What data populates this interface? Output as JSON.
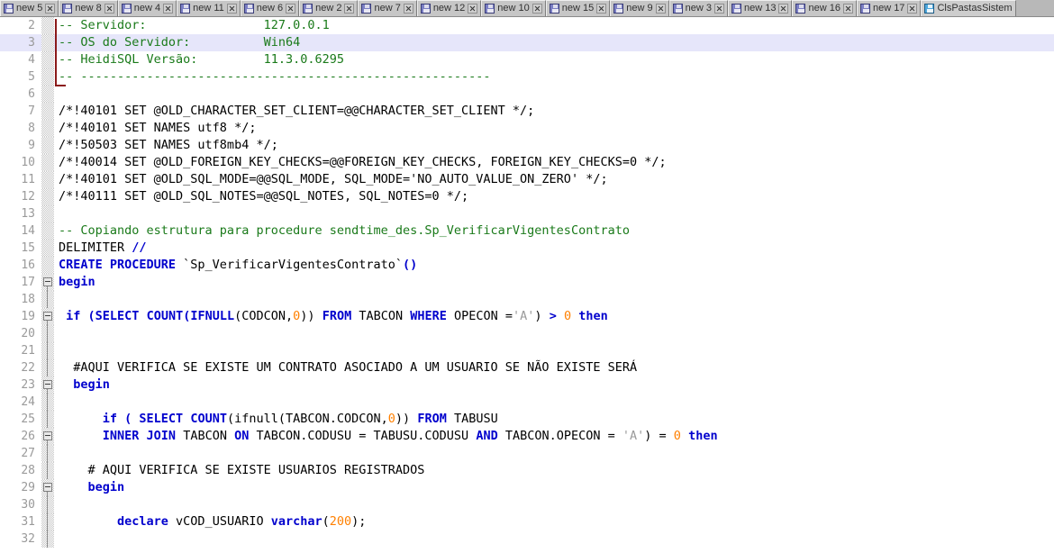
{
  "tabs": {
    "items": [
      {
        "label": "new 5",
        "icon": "floppy-disk-icon",
        "active": false
      },
      {
        "label": "new 8",
        "icon": "floppy-disk-icon",
        "active": false
      },
      {
        "label": "new 4",
        "icon": "floppy-disk-icon",
        "active": false
      },
      {
        "label": "new 11",
        "icon": "floppy-disk-icon",
        "active": false
      },
      {
        "label": "new 6",
        "icon": "floppy-disk-icon",
        "active": false
      },
      {
        "label": "new 2",
        "icon": "floppy-disk-icon",
        "active": false
      },
      {
        "label": "new 7",
        "icon": "floppy-disk-icon",
        "active": false
      },
      {
        "label": "new 12",
        "icon": "floppy-disk-icon",
        "active": false
      },
      {
        "label": "new 10",
        "icon": "floppy-disk-icon",
        "active": false
      },
      {
        "label": "new 15",
        "icon": "floppy-disk-icon",
        "active": false
      },
      {
        "label": "new 9",
        "icon": "floppy-disk-icon",
        "active": false
      },
      {
        "label": "new 3",
        "icon": "floppy-disk-icon",
        "active": false
      },
      {
        "label": "new 13",
        "icon": "floppy-disk-icon",
        "active": false
      },
      {
        "label": "new 16",
        "icon": "floppy-disk-icon",
        "active": false
      },
      {
        "label": "new 17",
        "icon": "floppy-disk-icon",
        "active": false
      },
      {
        "label": "ClsPastasSistem",
        "icon": "floppy-disk-icon",
        "active": true
      }
    ],
    "close_icon": "close-icon"
  },
  "editor": {
    "current_line": 3,
    "colors": {
      "keyword": "#0000cd",
      "comment": "#1a7a1a",
      "number": "#ff8000",
      "string": "#9a9a9a",
      "plain": "#000000",
      "current_line_bg": "#e6e6fa",
      "gutter_text": "#9a9a9a",
      "fold_bracket": "#8b1a1a"
    },
    "lines": [
      {
        "n": "2",
        "fold": "none",
        "tokens": [
          {
            "t": "-- Servidor:                ",
            "c": "cmt"
          },
          {
            "t": "127.0.0.1",
            "c": "cmt"
          }
        ]
      },
      {
        "n": "3",
        "fold": "none",
        "tokens": [
          {
            "t": "-- OS do Servidor:          ",
            "c": "cmt"
          },
          {
            "t": "Win64",
            "c": "cmt"
          }
        ]
      },
      {
        "n": "4",
        "fold": "none",
        "tokens": [
          {
            "t": "-- HeidiSQL Versão:         ",
            "c": "cmt"
          },
          {
            "t": "11.3.0.6295",
            "c": "cmt"
          }
        ]
      },
      {
        "n": "5",
        "fold": "none",
        "tokens": [
          {
            "t": "-- --------------------------------------------------------",
            "c": "cmt"
          }
        ]
      },
      {
        "n": "6",
        "fold": "none",
        "tokens": []
      },
      {
        "n": "7",
        "fold": "none",
        "tokens": [
          {
            "t": "/*!40101 SET @OLD_CHARACTER_SET_CLIENT=@@CHARACTER_SET_CLIENT */;",
            "c": "plain"
          }
        ]
      },
      {
        "n": "8",
        "fold": "none",
        "tokens": [
          {
            "t": "/*!40101 SET NAMES utf8 */;",
            "c": "plain"
          }
        ]
      },
      {
        "n": "9",
        "fold": "none",
        "tokens": [
          {
            "t": "/*!50503 SET NAMES utf8mb4 */;",
            "c": "plain"
          }
        ]
      },
      {
        "n": "10",
        "fold": "none",
        "tokens": [
          {
            "t": "/*!40014 SET @OLD_FOREIGN_KEY_CHECKS=@@FOREIGN_KEY_CHECKS, FOREIGN_KEY_CHECKS=0 */;",
            "c": "plain"
          }
        ]
      },
      {
        "n": "11",
        "fold": "none",
        "tokens": [
          {
            "t": "/*!40101 SET @OLD_SQL_MODE=@@SQL_MODE, SQL_MODE='NO_AUTO_VALUE_ON_ZERO' */;",
            "c": "plain"
          }
        ]
      },
      {
        "n": "12",
        "fold": "none",
        "tokens": [
          {
            "t": "/*!40111 SET @OLD_SQL_NOTES=@@SQL_NOTES, SQL_NOTES=0 */;",
            "c": "plain"
          }
        ]
      },
      {
        "n": "13",
        "fold": "none",
        "tokens": []
      },
      {
        "n": "14",
        "fold": "none",
        "tokens": [
          {
            "t": "-- Copiando estrutura para procedure sendtime_des.Sp_VerificarVigentesContrato",
            "c": "cmt"
          }
        ]
      },
      {
        "n": "15",
        "fold": "none",
        "tokens": [
          {
            "t": "DELIMITER ",
            "c": "plain"
          },
          {
            "t": "//",
            "c": "kw"
          }
        ]
      },
      {
        "n": "16",
        "fold": "none",
        "tokens": [
          {
            "t": "CREATE PROCEDURE ",
            "c": "kw"
          },
          {
            "t": "`Sp_VerificarVigentesContrato`",
            "c": "plain"
          },
          {
            "t": "()",
            "c": "kw"
          }
        ]
      },
      {
        "n": "17",
        "fold": "box",
        "tokens": [
          {
            "t": "begin",
            "c": "kw"
          }
        ]
      },
      {
        "n": "18",
        "fold": "line",
        "tokens": []
      },
      {
        "n": "19",
        "fold": "box",
        "tokens": [
          {
            "t": " if (",
            "c": "kw"
          },
          {
            "t": "SELECT",
            "c": "kw"
          },
          {
            "t": " ",
            "c": "plain"
          },
          {
            "t": "COUNT",
            "c": "kw"
          },
          {
            "t": "(",
            "c": "kw"
          },
          {
            "t": "IFNULL",
            "c": "kw"
          },
          {
            "t": "(CODCON,",
            "c": "plain"
          },
          {
            "t": "0",
            "c": "num"
          },
          {
            "t": ")) ",
            "c": "plain"
          },
          {
            "t": "FROM",
            "c": "kw"
          },
          {
            "t": " TABCON ",
            "c": "plain"
          },
          {
            "t": "WHERE",
            "c": "kw"
          },
          {
            "t": " OPECON =",
            "c": "plain"
          },
          {
            "t": "'A'",
            "c": "str"
          },
          {
            "t": ") ",
            "c": "plain"
          },
          {
            "t": ">",
            "c": "kw"
          },
          {
            "t": " ",
            "c": "plain"
          },
          {
            "t": "0",
            "c": "num"
          },
          {
            "t": " ",
            "c": "plain"
          },
          {
            "t": "then",
            "c": "kw"
          }
        ]
      },
      {
        "n": "20",
        "fold": "line",
        "tokens": []
      },
      {
        "n": "21",
        "fold": "line",
        "tokens": []
      },
      {
        "n": "22",
        "fold": "line",
        "tokens": [
          {
            "t": "  #AQUI VERIFICA SE EXISTE UM CONTRATO ASOCIADO A UM USUARIO SE NÃO EXISTE SERÁ",
            "c": "plain"
          }
        ]
      },
      {
        "n": "23",
        "fold": "box",
        "tokens": [
          {
            "t": "  begin",
            "c": "kw"
          }
        ]
      },
      {
        "n": "24",
        "fold": "line",
        "tokens": []
      },
      {
        "n": "25",
        "fold": "line",
        "tokens": [
          {
            "t": "      if ( ",
            "c": "kw"
          },
          {
            "t": "SELECT",
            "c": "kw"
          },
          {
            "t": " ",
            "c": "plain"
          },
          {
            "t": "COUNT",
            "c": "kw"
          },
          {
            "t": "(ifnull(TABCON.CODCON,",
            "c": "plain"
          },
          {
            "t": "0",
            "c": "num"
          },
          {
            "t": ")) ",
            "c": "plain"
          },
          {
            "t": "FROM",
            "c": "kw"
          },
          {
            "t": " TABUSU",
            "c": "plain"
          }
        ]
      },
      {
        "n": "26",
        "fold": "box",
        "tokens": [
          {
            "t": "      ",
            "c": "plain"
          },
          {
            "t": "INNER JOIN",
            "c": "kw"
          },
          {
            "t": " TABCON ",
            "c": "plain"
          },
          {
            "t": "ON",
            "c": "kw"
          },
          {
            "t": " TABCON.CODUSU = TABUSU.CODUSU ",
            "c": "plain"
          },
          {
            "t": "AND",
            "c": "kw"
          },
          {
            "t": " TABCON.OPECON = ",
            "c": "plain"
          },
          {
            "t": "'A'",
            "c": "str"
          },
          {
            "t": ") = ",
            "c": "plain"
          },
          {
            "t": "0",
            "c": "num"
          },
          {
            "t": " ",
            "c": "plain"
          },
          {
            "t": "then",
            "c": "kw"
          }
        ]
      },
      {
        "n": "27",
        "fold": "line",
        "tokens": []
      },
      {
        "n": "28",
        "fold": "line",
        "tokens": [
          {
            "t": "    # AQUI VERIFICA SE EXISTE USUARIOS REGISTRADOS",
            "c": "plain"
          }
        ]
      },
      {
        "n": "29",
        "fold": "box",
        "tokens": [
          {
            "t": "    begin",
            "c": "kw"
          }
        ]
      },
      {
        "n": "30",
        "fold": "line",
        "tokens": []
      },
      {
        "n": "31",
        "fold": "line",
        "tokens": [
          {
            "t": "        declare",
            "c": "kw"
          },
          {
            "t": " vCOD_USUARIO ",
            "c": "plain"
          },
          {
            "t": "varchar",
            "c": "kw"
          },
          {
            "t": "(",
            "c": "plain"
          },
          {
            "t": "200",
            "c": "num"
          },
          {
            "t": ");",
            "c": "plain"
          }
        ]
      },
      {
        "n": "32",
        "fold": "line",
        "tokens": []
      }
    ]
  }
}
